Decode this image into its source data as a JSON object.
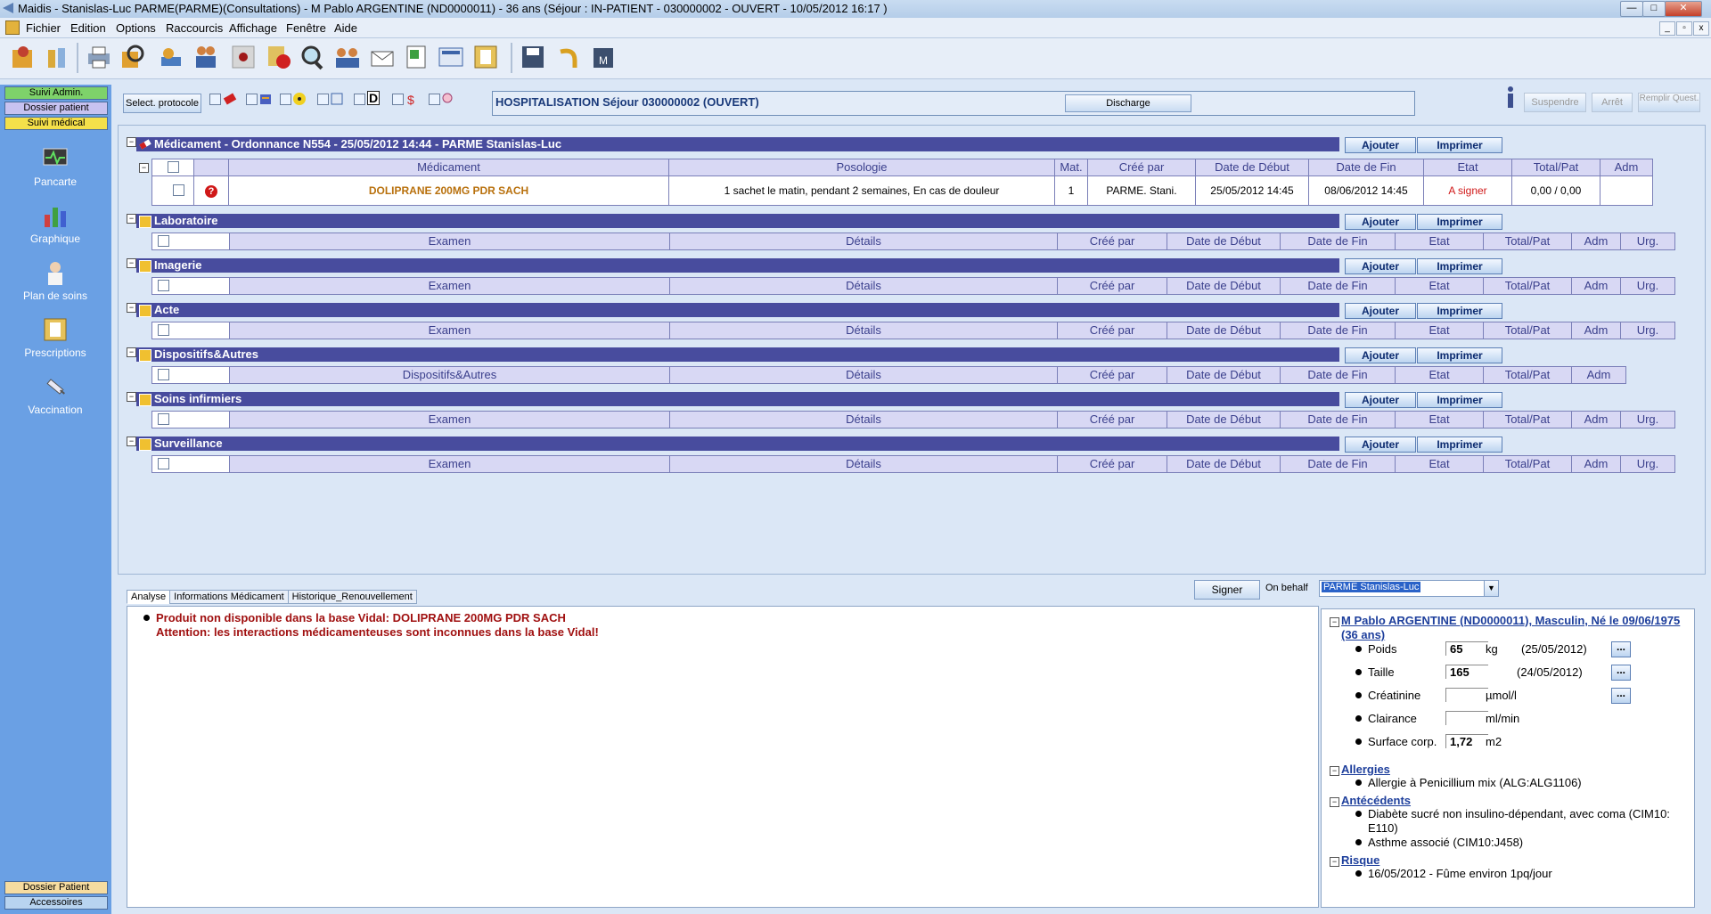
{
  "window": {
    "title": "Maidis - Stanislas-Luc PARME(PARME)(Consultations) - M Pablo ARGENTINE (ND0000011) - 36 ans (Séjour : IN-PATIENT - 030000002 - OUVERT - 10/05/2012 16:17 )"
  },
  "menu": [
    "Fichier",
    "Edition",
    "Options",
    "Raccourcis",
    "Affichage",
    "Fenêtre",
    "Aide"
  ],
  "sidebar": {
    "tabs": [
      "Suivi Admin.",
      "Dossier patient",
      "Suivi médical"
    ],
    "items": [
      "Pancarte",
      "Graphique",
      "Plan de soins",
      "Prescriptions",
      "Vaccination"
    ],
    "bottom_tabs": [
      "Dossier Patient",
      "Accessoires"
    ]
  },
  "protocol": {
    "select_label": "Select. protocole",
    "hospitalisation": "HOSPITALISATION Séjour 030000002 (OUVERT)",
    "discharge": "Discharge",
    "suspend": "Suspendre",
    "stop": "Arrêt",
    "fill_quest": "Remplir Quest."
  },
  "buttons": {
    "add": "Ajouter",
    "print": "Imprimer"
  },
  "medication": {
    "title": "Médicament - Ordonnance N554 - 25/05/2012 14:44 - PARME Stanislas-Luc",
    "columns": [
      "Médicament",
      "Posologie",
      "Mat.",
      "Créé par",
      "Date de Début",
      "Date de Fin",
      "Etat",
      "Total/Pat",
      "Adm"
    ],
    "row": {
      "name": "DOLIPRANE 200MG PDR SACH",
      "posology": "1 sachet le matin, pendant 2 semaines, En cas de douleur",
      "mat": "1",
      "created_by": "PARME. Stani.",
      "start": "25/05/2012 14:45",
      "end": "08/06/2012 14:45",
      "state": "A signer",
      "total": "0,00 / 0,00",
      "adm": ""
    }
  },
  "sections": [
    {
      "title": "Laboratoire",
      "columns": [
        "Examen",
        "Détails",
        "Créé par",
        "Date de Début",
        "Date de Fin",
        "Etat",
        "Total/Pat",
        "Adm",
        "Urg."
      ]
    },
    {
      "title": "Imagerie",
      "columns": [
        "Examen",
        "Détails",
        "Créé par",
        "Date de Début",
        "Date de Fin",
        "Etat",
        "Total/Pat",
        "Adm",
        "Urg."
      ]
    },
    {
      "title": "Acte",
      "columns": [
        "Examen",
        "Détails",
        "Créé par",
        "Date de Début",
        "Date de Fin",
        "Etat",
        "Total/Pat",
        "Adm",
        "Urg."
      ]
    },
    {
      "title": "Dispositifs&Autres",
      "columns": [
        "Dispositifs&Autres",
        "Détails",
        "Créé par",
        "Date de Début",
        "Date de Fin",
        "Etat",
        "Total/Pat",
        "Adm"
      ]
    },
    {
      "title": "Soins infirmiers",
      "columns": [
        "Examen",
        "Détails",
        "Créé par",
        "Date de Début",
        "Date de Fin",
        "Etat",
        "Total/Pat",
        "Adm",
        "Urg."
      ]
    },
    {
      "title": "Surveillance",
      "columns": [
        "Examen",
        "Détails",
        "Créé par",
        "Date de Début",
        "Date de Fin",
        "Etat",
        "Total/Pat",
        "Adm",
        "Urg."
      ]
    }
  ],
  "bottom": {
    "tabs": [
      "Analyse",
      "Informations Médicament",
      "Historique_Renouvellement"
    ],
    "sign": "Signer",
    "on_behalf_label": "On behalf",
    "on_behalf_value": "PARME Stanislas-Luc",
    "analysis_line1": "Produit non disponible dans la base Vidal: DOLIPRANE 200MG PDR SACH",
    "analysis_line2": "Attention: les interactions médicamenteuses sont inconnues dans la base Vidal!"
  },
  "patient": {
    "header": "M Pablo ARGENTINE (ND0000011), Masculin, Né le 09/06/1975 (36 ans)",
    "measures": [
      {
        "label": "Poids",
        "value": "65",
        "unit": "kg",
        "date": "(25/05/2012)"
      },
      {
        "label": "Taille",
        "value": "165",
        "unit": "",
        "date": "(24/05/2012)"
      },
      {
        "label": "Créatinine",
        "value": "",
        "unit": "µmol/l",
        "date": ""
      },
      {
        "label": "Clairance",
        "value": "",
        "unit": "ml/min",
        "date": ""
      },
      {
        "label": "Surface corp.",
        "value": "1,72",
        "unit": "m2",
        "date": ""
      }
    ],
    "dots": "...",
    "allergies_title": "Allergies",
    "allergies": [
      "Allergie à Penicillium mix (ALG:ALG1106)"
    ],
    "antecedents_title": "Antécédents",
    "antecedents": [
      "Diabète sucré non insulino-dépendant, avec coma (CIM10: E110)",
      "Asthme associé (CIM10:J458)"
    ],
    "risk_title": "Risque",
    "risks": [
      "16/05/2012 - Fûme environ 1pq/jour"
    ]
  }
}
